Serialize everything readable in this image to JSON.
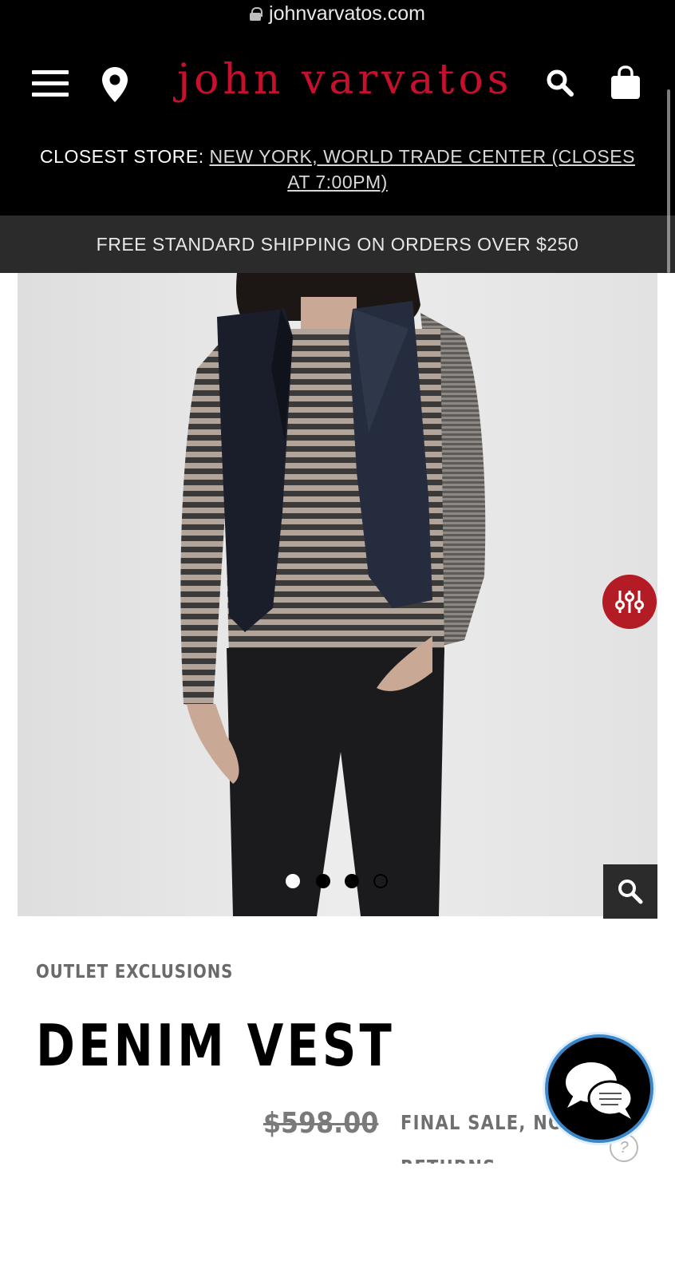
{
  "browser": {
    "url": "johnvarvatos.com"
  },
  "header": {
    "logo_text": "john varvatos",
    "closest_store_label": "CLOSEST STORE:",
    "closest_store_value": "NEW YORK, WORLD TRADE CENTER (CLOSES AT 7:00PM)",
    "shipping_banner": "FREE STANDARD SHIPPING ON ORDERS OVER $250",
    "icons": [
      "menu-icon",
      "location-pin-icon",
      "search-icon",
      "shopping-bag-icon"
    ]
  },
  "gallery": {
    "image_count": 4,
    "active_index": 0,
    "icons": [
      "filter-sliders-icon",
      "zoom-icon"
    ]
  },
  "product": {
    "category": "OUTLET EXCLUSIONS",
    "name": "DENIM VEST",
    "price": "$598.00",
    "sale_note": "FINAL SALE, NO",
    "sale_note_cont": "RETURNS"
  },
  "chat": {
    "icon": "chat-bubbles-icon"
  },
  "colors": {
    "brand_red": "#c8102e",
    "header_bg": "#000000",
    "banner_bg": "#2b2b2b",
    "chat_border": "#3a86c8"
  }
}
